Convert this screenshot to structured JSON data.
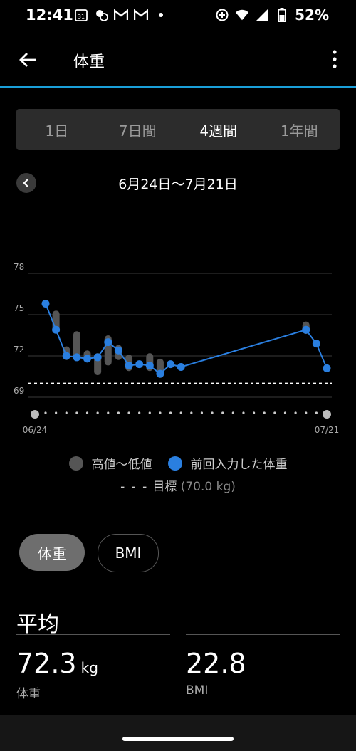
{
  "status": {
    "time": "12:41",
    "calendar_day": "31",
    "battery": "52%"
  },
  "header": {
    "title": "体重"
  },
  "tabs": [
    {
      "label": "1日",
      "active": false
    },
    {
      "label": "7日間",
      "active": false
    },
    {
      "label": "4週間",
      "active": true
    },
    {
      "label": "1年間",
      "active": false
    }
  ],
  "range": {
    "label": "6月24日〜7月21日"
  },
  "chart_data": {
    "type": "line",
    "x": [
      "06/24",
      "06/25",
      "06/26",
      "06/27",
      "06/28",
      "06/29",
      "06/30",
      "07/01",
      "07/02",
      "07/03",
      "07/04",
      "07/05",
      "07/06",
      "07/07",
      "07/19",
      "07/20",
      "07/21"
    ],
    "xlabel_ticks": [
      "06/24",
      "07/21"
    ],
    "y_ticks": [
      "78",
      "75",
      "72",
      "69"
    ],
    "ylim": [
      69,
      78
    ],
    "series": [
      {
        "name": "前回入力した体重",
        "color": "#2a7fe0",
        "values": [
          75.8,
          73.9,
          72.0,
          71.9,
          71.8,
          71.9,
          73.0,
          72.4,
          71.3,
          71.4,
          71.3,
          70.7,
          71.4,
          71.2,
          73.9,
          72.9,
          71.1
        ]
      },
      {
        "name": "高値〜低値",
        "color": "#555555",
        "high": [
          75.8,
          75.3,
          72.7,
          73.8,
          72.4,
          72.2,
          73.5,
          72.8,
          72.1,
          71.4,
          72.2,
          71.8,
          71.4,
          71.2,
          74.5,
          72.9,
          71.1
        ],
        "low": [
          75.8,
          73.8,
          71.7,
          71.7,
          71.6,
          70.6,
          71.3,
          71.7,
          70.9,
          71.4,
          70.9,
          70.4,
          71.4,
          71.2,
          73.6,
          72.9,
          71.1
        ]
      }
    ],
    "goal": 70.0,
    "grid": true
  },
  "legend": {
    "range_label": "高値〜低値",
    "last_label": "前回入力した体重",
    "goal_label": "目標",
    "goal_value": "(70.0 kg)",
    "range_color": "#555555",
    "last_color": "#2a7fe0"
  },
  "toggle": {
    "weight": "体重",
    "bmi": "BMI"
  },
  "average": {
    "title": "平均",
    "weight_value": "72.3",
    "weight_unit": "kg",
    "weight_label": "体重",
    "bmi_value": "22.8",
    "bmi_label": "BMI"
  }
}
